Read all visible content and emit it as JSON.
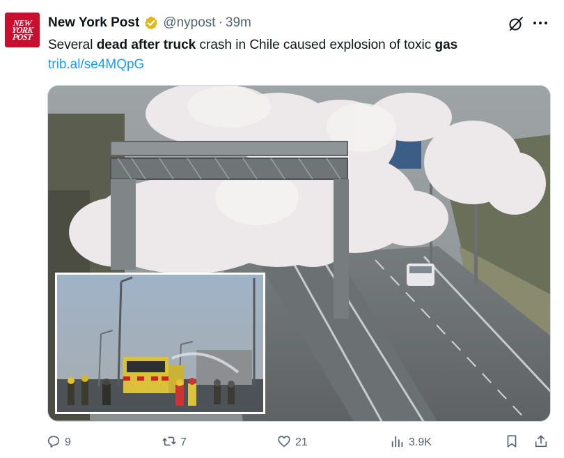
{
  "author": {
    "avatar_lines": [
      "NEW",
      "YORK",
      "POST"
    ],
    "name": "New York Post",
    "handle": "@nypost",
    "separator": "·",
    "time": "39m"
  },
  "tweet": {
    "text_parts": [
      {
        "text": "Several ",
        "bold": false
      },
      {
        "text": "dead after truck",
        "bold": true
      },
      {
        "text": " crash in Chile caused explosion of toxic ",
        "bold": false
      },
      {
        "text": "gas",
        "bold": true
      }
    ],
    "link": "trib.al/se4MQpG"
  },
  "media": {
    "main_description": "highway gantry engulfed in white toxic gas cloud, white van on road",
    "inset_description": "firefighters spraying water near fire truck on highway"
  },
  "actions": {
    "replies": "9",
    "reposts": "7",
    "likes": "21",
    "views": "3.9K"
  },
  "icons": {
    "verified": "verified-badge-icon",
    "grok": "grok-icon",
    "more": "more-icon",
    "reply": "reply-icon",
    "repost": "repost-icon",
    "like": "heart-icon",
    "views": "views-icon",
    "bookmark": "bookmark-icon",
    "share": "share-icon"
  },
  "colors": {
    "brand_red": "#c8102e",
    "link_blue": "#1d9bf0",
    "muted": "#536471",
    "verified_gold": "#e2b719"
  }
}
